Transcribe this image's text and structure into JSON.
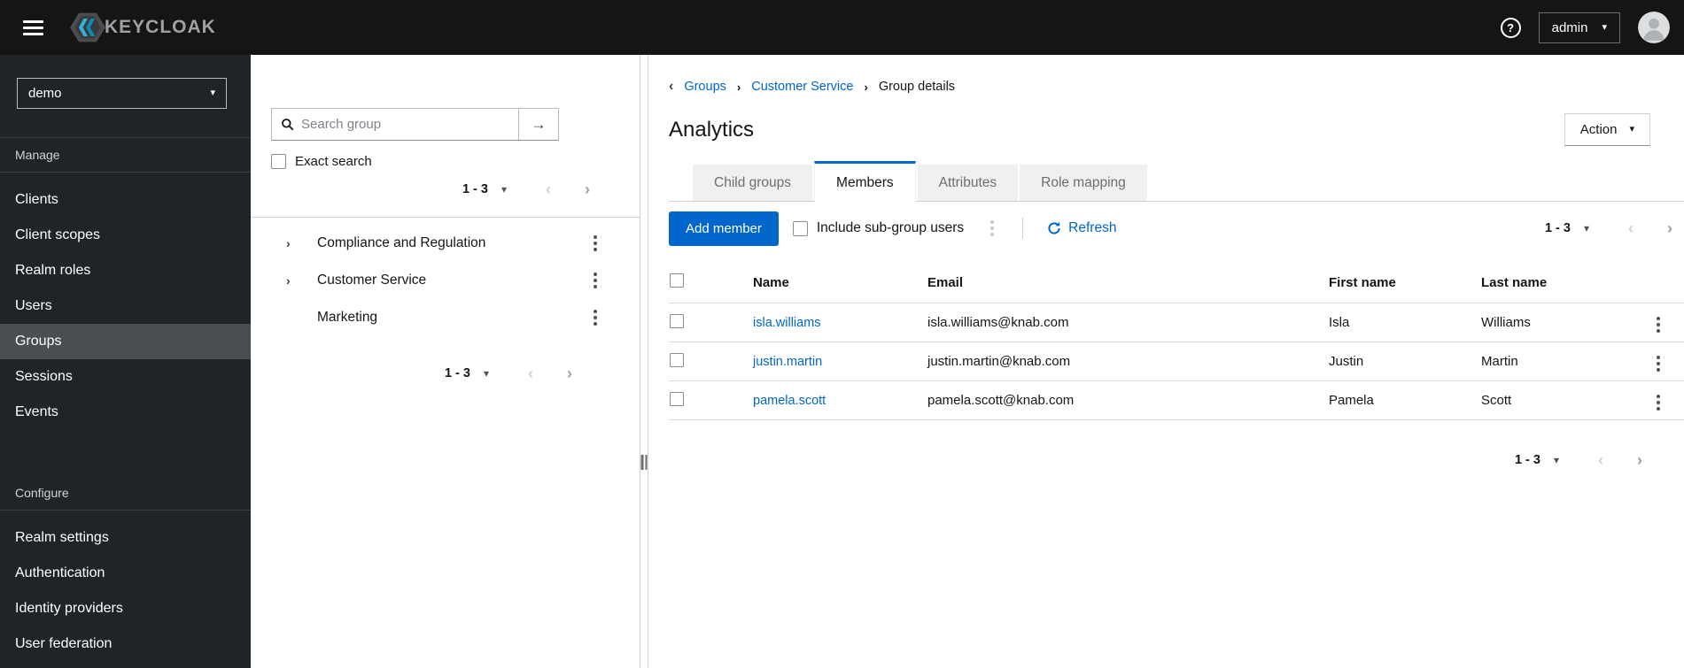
{
  "colors": {
    "accent": "#0066cc",
    "link": "#0066cc",
    "masthead-bg": "#151515",
    "sidebar-bg": "#212427",
    "sidebar-selected": "#4a4d51"
  },
  "icons": {
    "caret_down": "▾",
    "chevron_right": "›",
    "chevron_left": "‹",
    "arrow_right": "→",
    "help": "?"
  },
  "masthead": {
    "brand": "KEYCLOAK",
    "user": "admin"
  },
  "sidebar": {
    "realm": "demo",
    "sections": [
      {
        "label": "Manage",
        "items": [
          "Clients",
          "Client scopes",
          "Realm roles",
          "Users",
          "Groups",
          "Sessions",
          "Events"
        ],
        "selected_item": "Groups"
      },
      {
        "label": "Configure",
        "items": [
          "Realm settings",
          "Authentication",
          "Identity providers",
          "User federation"
        ]
      }
    ]
  },
  "tree": {
    "search_placeholder": "Search group",
    "search_value": "",
    "exact_search_label": "Exact search",
    "pagination_range": "1 - 3",
    "groups": [
      {
        "label": "Compliance and Regulation",
        "expandable": true
      },
      {
        "label": "Customer Service",
        "expandable": true
      },
      {
        "label": "Marketing",
        "expandable": false
      }
    ]
  },
  "main": {
    "breadcrumb": {
      "items": [
        "Groups",
        "Customer Service",
        "Group details"
      ]
    },
    "title": "Analytics",
    "action_button": "Action",
    "tabs": [
      "Child groups",
      "Members",
      "Attributes",
      "Role mapping"
    ],
    "active_tab": "Members",
    "toolbar": {
      "add_member": "Add member",
      "include_subgroups": "Include sub-group users",
      "refresh": "Refresh",
      "pagination_range": "1 - 3"
    },
    "table": {
      "columns": [
        "Name",
        "Email",
        "First name",
        "Last name"
      ],
      "rows": [
        {
          "name": "isla.williams",
          "email": "isla.williams@knab.com",
          "first_name": "Isla",
          "last_name": "Williams"
        },
        {
          "name": "justin.martin",
          "email": "justin.martin@knab.com",
          "first_name": "Justin",
          "last_name": "Martin"
        },
        {
          "name": "pamela.scott",
          "email": "pamela.scott@knab.com",
          "first_name": "Pamela",
          "last_name": "Scott"
        }
      ]
    },
    "pagination_range": "1 - 3"
  }
}
